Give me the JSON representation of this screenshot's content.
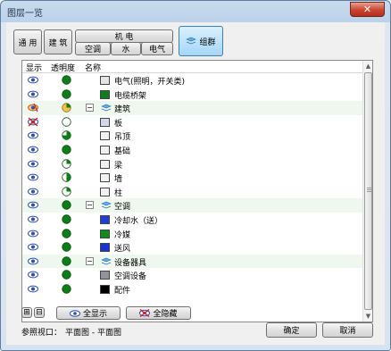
{
  "window": {
    "title": "图层一览",
    "close_glyph": "✕"
  },
  "toolbar": {
    "common": "通 用",
    "architecture": "建 筑",
    "mep": "机 电",
    "hvac": "空调",
    "water": "水",
    "electric": "电气",
    "group": "组群"
  },
  "columns": {
    "visible": "显示",
    "opacity": "透明度",
    "name": "名称"
  },
  "rows": [
    {
      "name": "电气(照明，开关类)",
      "type": "layer",
      "color": "#e4e4e4",
      "eye": "normal",
      "opacity": "full"
    },
    {
      "name": "电缆桥架",
      "type": "layer",
      "color": "#0f7c1d",
      "eye": "normal",
      "opacity": "full"
    },
    {
      "name": "建筑",
      "type": "group",
      "eye": "mixed",
      "opacity": "mixed",
      "expand": "−"
    },
    {
      "name": "板",
      "type": "layer",
      "color": "#d3d7ee",
      "eye": "hidden",
      "opacity": "empty"
    },
    {
      "name": "吊顶",
      "type": "layer",
      "color": "#f2f2f2",
      "eye": "normal",
      "opacity": "three_quarter"
    },
    {
      "name": "基础",
      "type": "layer",
      "color": "#f2f2f2",
      "eye": "normal",
      "opacity": "full"
    },
    {
      "name": "梁",
      "type": "layer",
      "color": "#f2f2f2",
      "eye": "normal",
      "opacity": "quarter"
    },
    {
      "name": "墙",
      "type": "layer",
      "color": "#f2f2f2",
      "eye": "normal",
      "opacity": "half"
    },
    {
      "name": "柱",
      "type": "layer",
      "color": "#f2f2f2",
      "eye": "normal",
      "opacity": "quarter"
    },
    {
      "name": "空调",
      "type": "group",
      "eye": "normal",
      "opacity": "full",
      "expand": "−"
    },
    {
      "name": "冷却水（送）",
      "type": "layer",
      "color": "#1f3fd0",
      "eye": "normal",
      "opacity": "full"
    },
    {
      "name": "冷媒",
      "type": "layer",
      "color": "#138a1c",
      "eye": "normal",
      "opacity": "full"
    },
    {
      "name": "送风",
      "type": "layer",
      "color": "#1733d6",
      "eye": "normal",
      "opacity": "full"
    },
    {
      "name": "设备器具",
      "type": "group",
      "eye": "normal",
      "opacity": "full",
      "expand": "−"
    },
    {
      "name": "空调设备",
      "type": "layer",
      "color": "#8f959b",
      "eye": "normal",
      "opacity": "full"
    },
    {
      "name": "配件",
      "type": "layer",
      "color": "#000000",
      "eye": "normal",
      "opacity": "full"
    }
  ],
  "bottom": {
    "expand_all": "⊞",
    "collapse_all": "⊟",
    "show_all": "全显示",
    "hide_all": "全隐藏",
    "ref_label": "参照视口：",
    "ref_value": "平面图 - 平面图",
    "ok": "确定",
    "cancel": "取消"
  },
  "colors": {
    "accent": "#3c7fb1",
    "opacity_green": "#0d7d18",
    "eye_blue": "#2c4fb0"
  },
  "icons": {
    "eye": "eye-icon",
    "opacity": "opacity-pie-icon",
    "group": "group-layers-icon"
  }
}
